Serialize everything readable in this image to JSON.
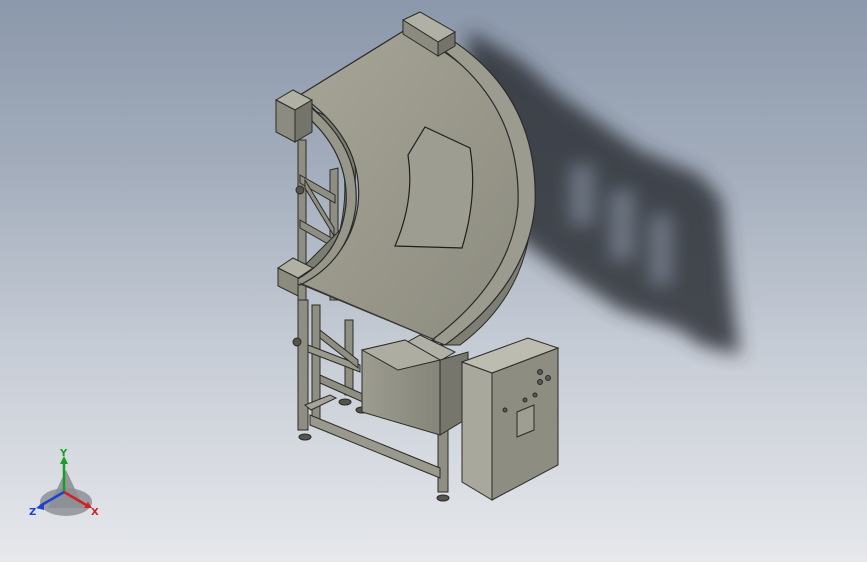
{
  "app": {
    "view": "isometric-3d-model",
    "model": "curved-belt-conveyor"
  },
  "colors": {
    "background_top": "#8b98ab",
    "background_bottom": "#e6e8ec",
    "part_light": "#a8a79b",
    "part_mid": "#8f8e83",
    "part_dark": "#6c6b62",
    "edge": "#2b2b27",
    "shadow": "#2e3238",
    "axis_x": "#d02020",
    "axis_y": "#16a020",
    "axis_z": "#2040d0"
  },
  "triad": {
    "x_label": "X",
    "y_label": "Y",
    "z_label": "Z"
  },
  "icons": {
    "triad": "view-orientation-triad-icon"
  }
}
